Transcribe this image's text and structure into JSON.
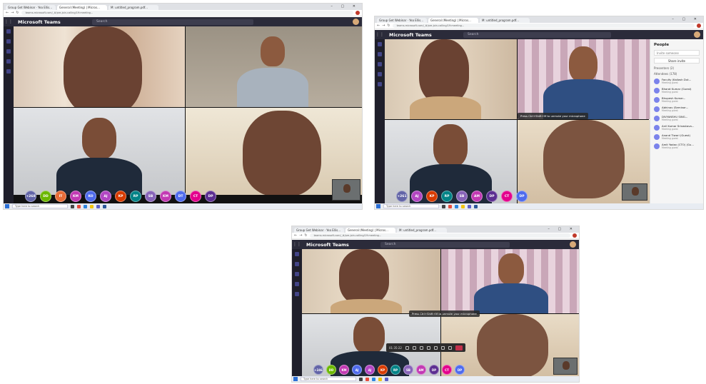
{
  "screenshots": [
    {
      "tabs": [
        "Group Get Webinar · Yea Ellis...",
        "General (Meeting) | Micros...",
        "M: untitled_program.pdf..."
      ],
      "url": "teams.microsoft.com/_#/pre-join-calling/19:meeting...",
      "app_name": "Microsoft Teams",
      "search_placeholder": "Search",
      "avatars": [
        {
          "text": "+268",
          "color": "#6264a7"
        },
        {
          "text": "DD",
          "color": "#6bb700"
        },
        {
          "text": "IT",
          "color": "#e66c37"
        },
        {
          "text": "KM",
          "color": "#c239b3"
        },
        {
          "text": "KO",
          "color": "#4f6bed"
        },
        {
          "text": "AJ",
          "color": "#b146c2"
        },
        {
          "text": "KP",
          "color": "#d83b01"
        },
        {
          "text": "RP",
          "color": "#038387"
        },
        {
          "text": "SB",
          "color": "#8764b8"
        },
        {
          "text": "KM",
          "color": "#c239b3"
        },
        {
          "text": "DT",
          "color": "#4f6bed"
        },
        {
          "text": "CT",
          "color": "#e3008c"
        },
        {
          "text": "DP",
          "color": "#5c2e91"
        }
      ],
      "taskbar_search": "Type here to search",
      "clock_time": "",
      "clock_date": ""
    },
    {
      "tabs": [
        "Group Get Webinar · Yea Ellis...",
        "General (Meeting) | Micros...",
        "M: untitled_program.pdf..."
      ],
      "url": "teams.microsoft.com/_#/pre-join-calling/19:meeting...",
      "app_name": "Microsoft Teams",
      "search_placeholder": "Search",
      "toast": "Press Ctrl+Shift+M to unmute your microphone",
      "avatars": [
        {
          "text": "+261",
          "color": "#6264a7"
        },
        {
          "text": "AJ",
          "color": "#b146c2"
        },
        {
          "text": "KP",
          "color": "#d83b01"
        },
        {
          "text": "RP",
          "color": "#038387"
        },
        {
          "text": "SB",
          "color": "#8764b8"
        },
        {
          "text": "AM",
          "color": "#c239b3"
        },
        {
          "text": "DP",
          "color": "#5c2e91"
        },
        {
          "text": "CT",
          "color": "#e3008c"
        },
        {
          "text": "DP",
          "color": "#4f6bed"
        }
      ],
      "people": {
        "title": "People",
        "invite_placeholder": "Invite someone",
        "share_label": "Share invite",
        "presenters_label": "Presenters (2)",
        "attendees_label": "Attendees (178)",
        "rows": [
          {
            "name": "Faculty (Kailash Dut...",
            "role": "Meeting guest"
          },
          {
            "name": "Bharat Kumar (Guest)",
            "role": "Meeting guest"
          },
          {
            "name": "Bhupesh Kumar...",
            "role": "Meeting guest"
          },
          {
            "name": "Abhinav (Seminar...",
            "role": "Meeting guest"
          },
          {
            "name": "DIVYANSHU SING...",
            "role": "Meeting guest"
          },
          {
            "name": "Anil Kumar Srivastava...",
            "role": "Meeting guest"
          },
          {
            "name": "Anand Tiwari (Guest)",
            "role": "Meeting guest"
          },
          {
            "name": "Amit Yadav (CTO) (Gu...",
            "role": "Meeting guest"
          }
        ]
      },
      "taskbar_search": "Type here to search",
      "clock_time": "",
      "clock_date": ""
    },
    {
      "tabs": [
        "Group Get Webinar · Yea Ellis...",
        "General (Meeting) | Micros...",
        "M: untitled_program.pdf..."
      ],
      "url": "teams.microsoft.com/_#/pre-join-calling/19:meeting...",
      "app_name": "Microsoft Teams",
      "search_placeholder": "Search",
      "toast": "Press Ctrl+Shift+M to unmute your microphone",
      "control_time": "01:35:22",
      "avatars": [
        {
          "text": "+246",
          "color": "#6264a7"
        },
        {
          "text": "DD",
          "color": "#6bb700"
        },
        {
          "text": "KM",
          "color": "#c239b3"
        },
        {
          "text": "AJ",
          "color": "#4f6bed"
        },
        {
          "text": "AJ",
          "color": "#b146c2"
        },
        {
          "text": "KP",
          "color": "#d83b01"
        },
        {
          "text": "RP",
          "color": "#038387"
        },
        {
          "text": "SB",
          "color": "#8764b8"
        },
        {
          "text": "AM",
          "color": "#c239b3"
        },
        {
          "text": "DP",
          "color": "#5c2e91"
        },
        {
          "text": "CT",
          "color": "#e3008c"
        },
        {
          "text": "DP",
          "color": "#4f6bed"
        }
      ],
      "taskbar_search": "Type here to search",
      "clock_time": "",
      "clock_date": ""
    }
  ]
}
